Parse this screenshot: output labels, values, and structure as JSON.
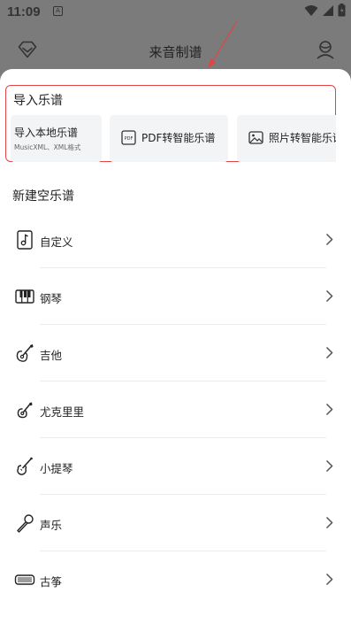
{
  "status_bar": {
    "time": "11:09",
    "sim_label": "A"
  },
  "app_bar": {
    "title": "来音制谱",
    "left_icon": "diamond-vip-icon",
    "right_icon": "user-profile-icon"
  },
  "import_section": {
    "title": "导入乐谱",
    "cards": [
      {
        "label": "导入本地乐谱",
        "sublabel": "MusicXML、XML格式"
      },
      {
        "label": "PDF转智能乐谱",
        "icon": "pdf-icon",
        "icon_text": "PDF"
      },
      {
        "label": "照片转智能乐谱",
        "icon": "image-icon"
      }
    ]
  },
  "new_section": {
    "title": "新建空乐谱",
    "items": [
      {
        "label": "自定义",
        "icon": "music-note-icon"
      },
      {
        "label": "钢琴",
        "icon": "piano-icon"
      },
      {
        "label": "吉他",
        "icon": "guitar-icon"
      },
      {
        "label": "尤克里里",
        "icon": "ukulele-icon"
      },
      {
        "label": "小提琴",
        "icon": "violin-icon"
      },
      {
        "label": "声乐",
        "icon": "microphone-icon"
      },
      {
        "label": "古筝",
        "icon": "guzheng-icon"
      }
    ]
  },
  "colors": {
    "highlight_border": "#e04545",
    "card_bg": "#f3f4f6",
    "overlay": "#7b7b7b"
  }
}
